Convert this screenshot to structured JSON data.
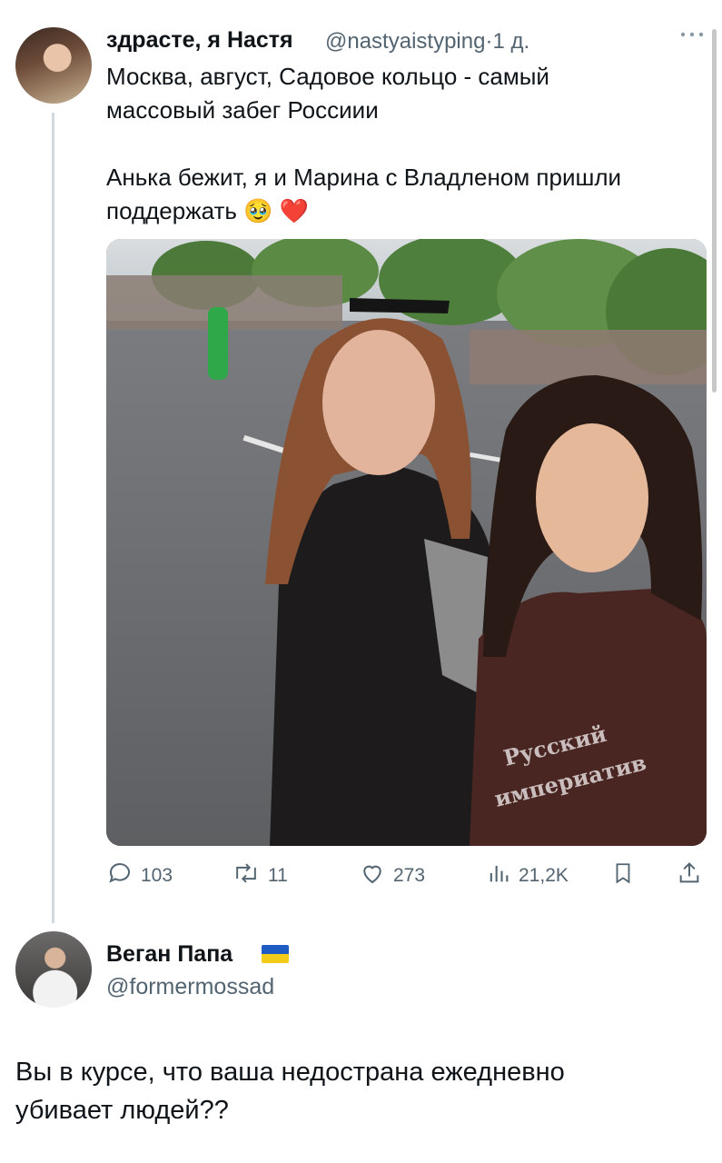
{
  "tweet": {
    "author_name": "здрасте, я Настя",
    "handle": "@nastyaistyping",
    "separator": "·",
    "time": "1 д.",
    "more_icon": "more-horizontal-icon",
    "text_lines": [
      "Москва, август, Садовое кольцо - самый",
      "массовый забег Россиии",
      "Анька бежит, я и Марина с Владленом пришли",
      "поддержать 🥹 ❤️"
    ],
    "photo": {
      "watermark_line1": "Русский",
      "watermark_line2": "империатив"
    },
    "actions": {
      "replies": "103",
      "retweets": "11",
      "likes": "273",
      "views": "21,2K"
    }
  },
  "reply": {
    "author_name": "Веган Папа",
    "flag": "ukraine-flag",
    "handle": "@formermossad",
    "text_lines": [
      "Вы в курсе, что ваша недострана ежедневно",
      "убивает людей??"
    ]
  },
  "colors": {
    "text": "#0f1419",
    "secondary": "#536471",
    "thread_line": "#cfd9de"
  }
}
